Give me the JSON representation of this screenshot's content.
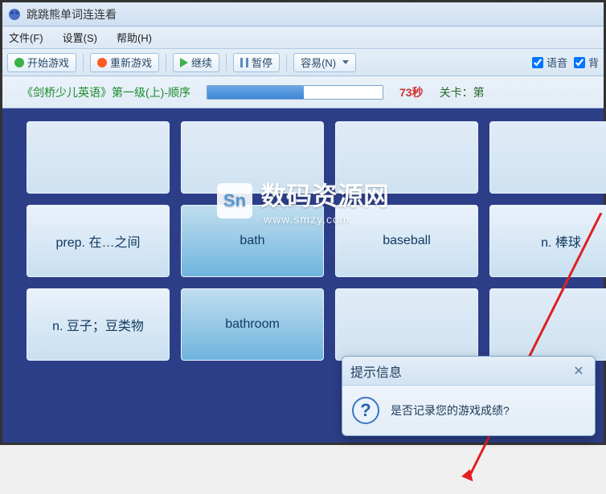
{
  "title": "跳跳熊单词连连看",
  "menubar": [
    {
      "label": "文件(F)"
    },
    {
      "label": "设置(S)"
    },
    {
      "label": "帮助(H)"
    }
  ],
  "toolbar": {
    "start": "开始游戏",
    "restart": "重新游戏",
    "continue": "继续",
    "pause": "暂停",
    "difficulty": "容易(N)",
    "sound_label": "语音",
    "bg_label": "背"
  },
  "status": {
    "course": "《剑桥少儿英语》第一级(上)-顺序",
    "progress_pct": 55,
    "time_label": "73秒",
    "stage_label": "关卡：第"
  },
  "cards": [
    [
      {
        "text": "",
        "kind": "empty"
      },
      {
        "text": "",
        "kind": "empty"
      },
      {
        "text": "",
        "kind": "empty"
      },
      {
        "text": "",
        "kind": "empty"
      }
    ],
    [
      {
        "text": "prep. 在…之间",
        "kind": "normal"
      },
      {
        "text": "bath",
        "kind": "alt"
      },
      {
        "text": "baseball",
        "kind": "normal"
      },
      {
        "text": "n. 棒球",
        "kind": "normal"
      }
    ],
    [
      {
        "text": "n. 豆子；豆类物",
        "kind": "normal"
      },
      {
        "text": "bathroom",
        "kind": "alt"
      },
      {
        "text": "",
        "kind": "dialog"
      },
      {
        "text": "",
        "kind": "dialog"
      }
    ]
  ],
  "dialog": {
    "title": "提示信息",
    "message": "是否记录您的游戏成绩?"
  },
  "watermark": {
    "brand": "数码资源网",
    "sub": "www.smzy.com",
    "logo": "Sn"
  }
}
